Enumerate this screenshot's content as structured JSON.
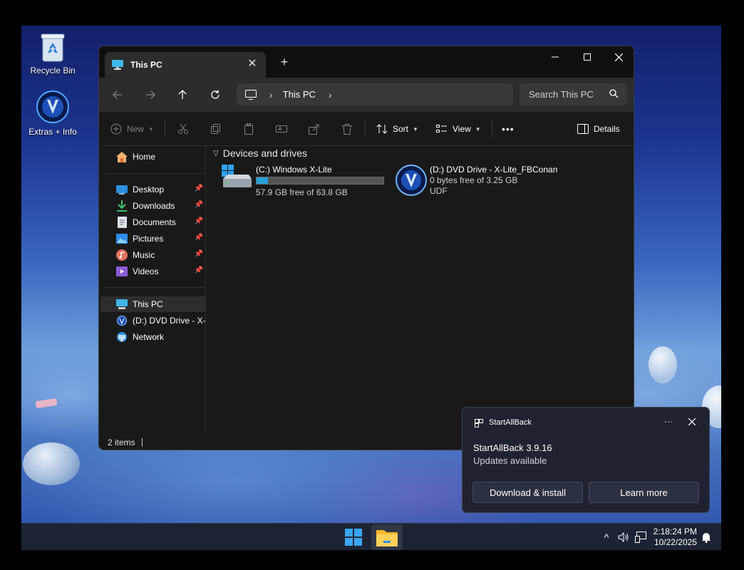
{
  "desktop": {
    "icons": [
      {
        "label": "Recycle Bin",
        "icon": "recycle-bin-icon"
      },
      {
        "label": "Extras + Info",
        "icon": "extras-info-icon"
      }
    ]
  },
  "explorer": {
    "tab_title": "This PC",
    "new_tab": "+",
    "address": {
      "crumb": "This PC"
    },
    "search_placeholder": "Search This PC",
    "commands": {
      "new": "New",
      "sort": "Sort",
      "view": "View",
      "more": "•••",
      "details": "Details"
    },
    "sidebar": {
      "home": "Home",
      "quick_access": [
        {
          "label": "Desktop",
          "icon": "desktop-folder-icon",
          "pinned": true
        },
        {
          "label": "Downloads",
          "icon": "downloads-folder-icon",
          "pinned": true
        },
        {
          "label": "Documents",
          "icon": "documents-folder-icon",
          "pinned": true
        },
        {
          "label": "Pictures",
          "icon": "pictures-folder-icon",
          "pinned": true
        },
        {
          "label": "Music",
          "icon": "music-folder-icon",
          "pinned": true
        },
        {
          "label": "Videos",
          "icon": "videos-folder-icon",
          "pinned": true
        }
      ],
      "this_pc": "This PC",
      "dvd": "(D:) DVD Drive - X-Lite_FBConan",
      "network": "Network"
    },
    "group_header": "Devices and drives",
    "drives": {
      "c": {
        "name": "(C:) Windows X-Lite",
        "free": "57.9 GB free of 63.8 GB",
        "used_fraction": 0.09
      },
      "d": {
        "name": "(D:) DVD Drive - X-Lite_FBConan",
        "free": "0 bytes free of 3.25 GB",
        "fs": "UDF"
      }
    },
    "status": {
      "count": "2 items"
    }
  },
  "toast": {
    "app_name": "StartAllBack",
    "more": "···",
    "title": "StartAllBack 3.9.16",
    "message": "Updates available",
    "primary_button": "Download & install",
    "secondary_button": "Learn more"
  },
  "taskbar": {
    "time": "2:18:24 PM",
    "date": "10/22/2025",
    "tray_chevron": "^"
  },
  "colors": {
    "accent": "#26a0da",
    "window_bg": "#191919",
    "toolbar_bg": "#2c2c2c",
    "taskbar_bg": "#1c2433",
    "toast_bg": "#1f2330"
  }
}
